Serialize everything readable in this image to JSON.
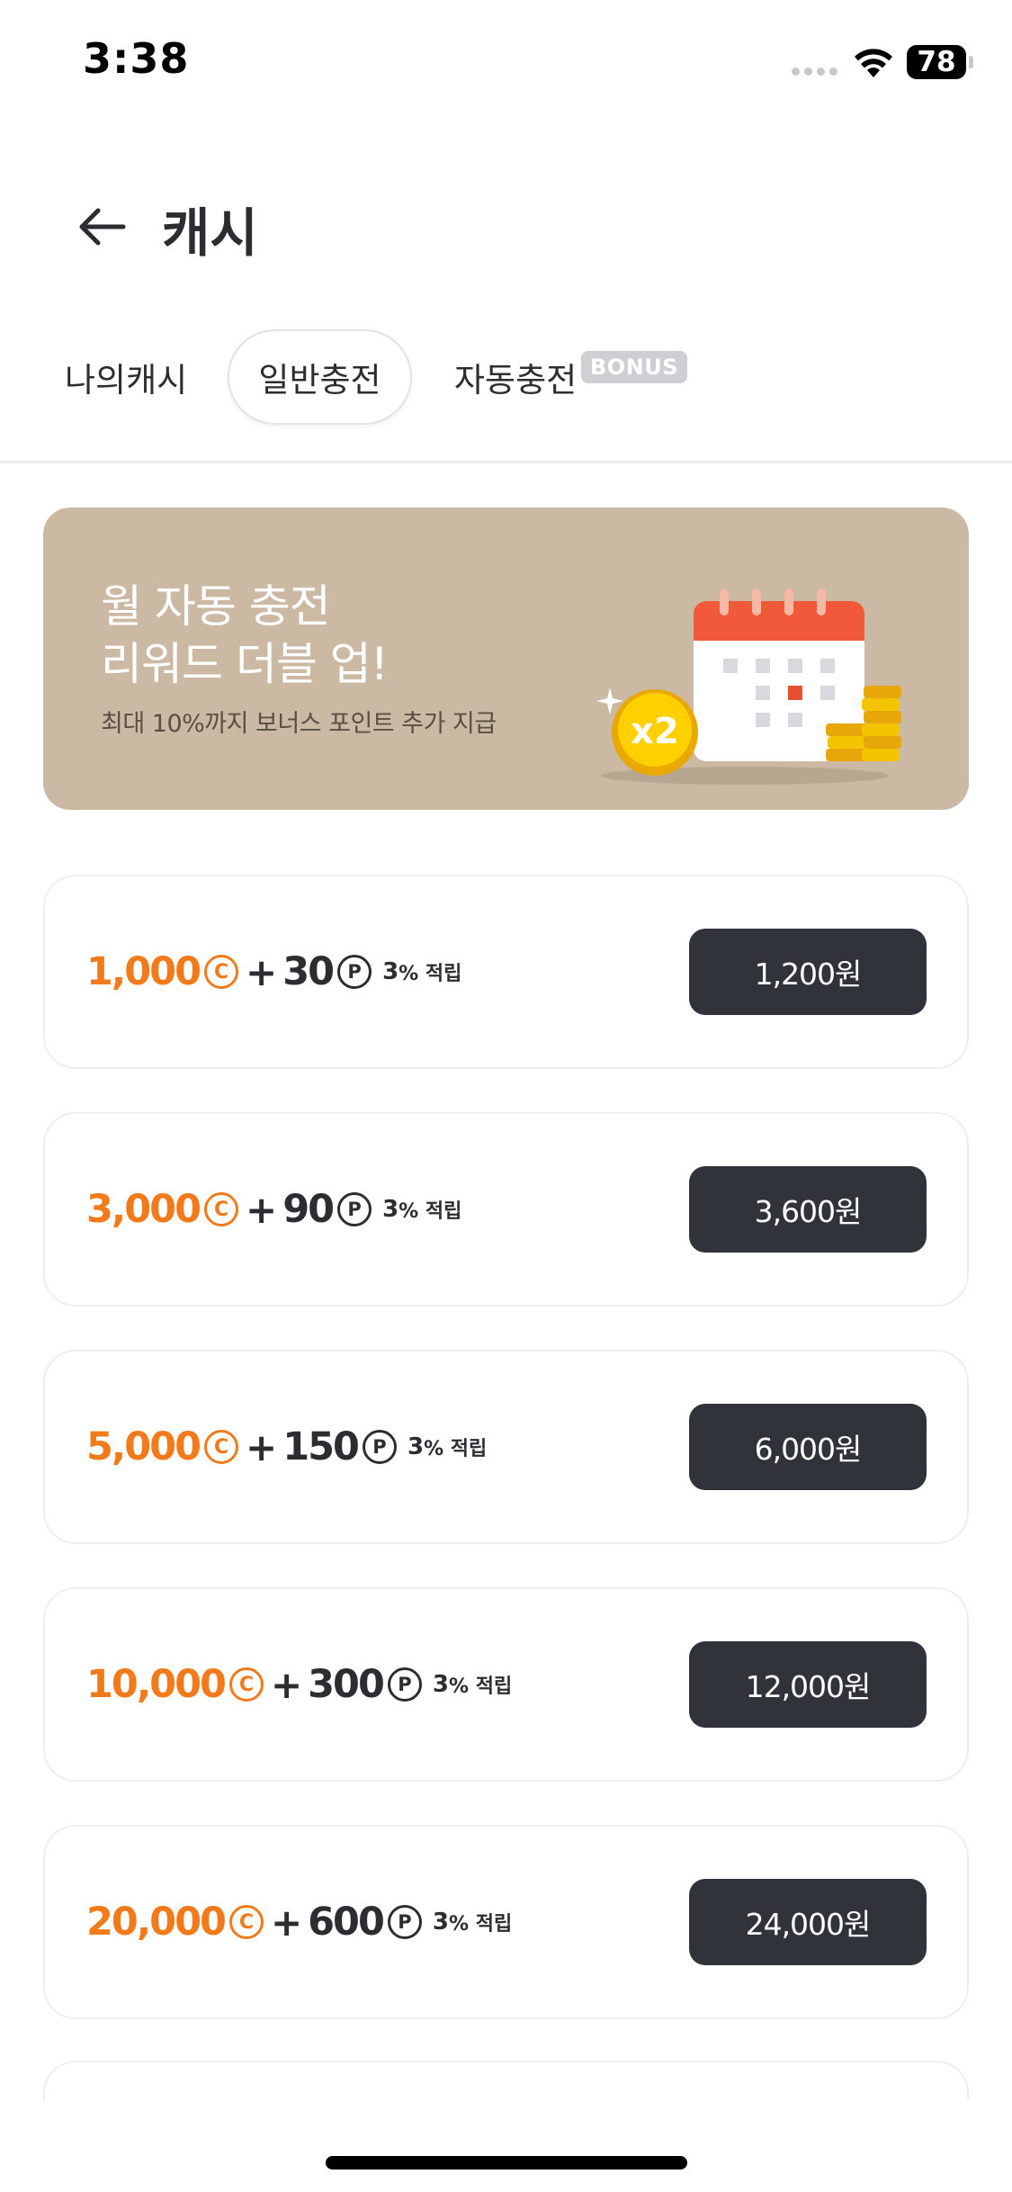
{
  "status_bar": {
    "time": "3:38",
    "battery": "78"
  },
  "header": {
    "title": "캐시"
  },
  "tabs": [
    {
      "label": "나의캐시"
    },
    {
      "label": "일반충전",
      "selected": true
    },
    {
      "label": "자동충전",
      "badge": "BONUS"
    }
  ],
  "banner": {
    "title_line1": "월 자동 충전",
    "title_line2": "리워드 더블 업!",
    "subtitle": "최대 10%까지 보너스 포인트 추가 지급",
    "badge": "x2"
  },
  "products": [
    {
      "cash": "1,000",
      "points": "30",
      "rate": "3",
      "rate_suffix": "% 적립",
      "price": "1,200원"
    },
    {
      "cash": "3,000",
      "points": "90",
      "rate": "3",
      "rate_suffix": "% 적립",
      "price": "3,600원"
    },
    {
      "cash": "5,000",
      "points": "150",
      "rate": "3",
      "rate_suffix": "% 적립",
      "price": "6,000원"
    },
    {
      "cash": "10,000",
      "points": "300",
      "rate": "3",
      "rate_suffix": "% 적립",
      "price": "12,000원"
    },
    {
      "cash": "20,000",
      "points": "600",
      "rate": "3",
      "rate_suffix": "% 적립",
      "price": "24,000원"
    }
  ],
  "symbols": {
    "cash_symbol": "C",
    "point_symbol": "P",
    "plus": "+"
  },
  "colors": {
    "accent": "#f27a1a",
    "banner_bg": "#cbb9a4",
    "button_bg": "#31333a"
  },
  "icons": [
    "back-arrow-icon",
    "wifi-icon",
    "battery-icon",
    "calendar-icon",
    "coin-icon"
  ]
}
